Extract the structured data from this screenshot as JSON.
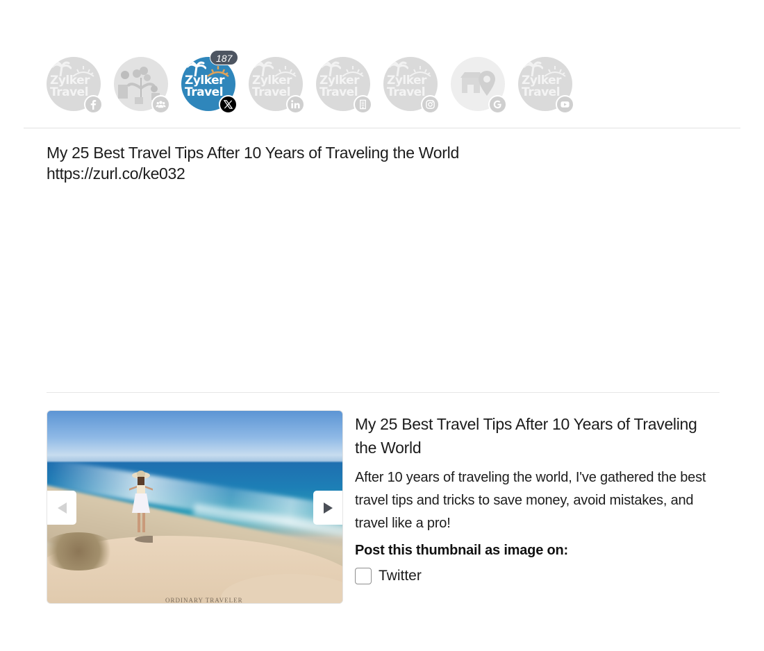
{
  "accounts": {
    "items": [
      {
        "name": "Zylker Travel",
        "network": "Facebook",
        "badge_icon": "facebook-icon",
        "active": false
      },
      {
        "name": "Community Group",
        "network": "Facebook Group",
        "badge_icon": "group-icon",
        "active": false
      },
      {
        "name": "Zylker Travel",
        "network": "X (Twitter)",
        "badge_icon": "x-icon",
        "active": true
      },
      {
        "name": "Zylker Travel",
        "network": "LinkedIn",
        "badge_icon": "linkedin-icon",
        "active": false
      },
      {
        "name": "Zylker Travel",
        "network": "LinkedIn Page",
        "badge_icon": "building-icon",
        "active": false
      },
      {
        "name": "Zylker Travel",
        "network": "Instagram",
        "badge_icon": "instagram-icon",
        "active": false
      },
      {
        "name": "Store Location",
        "network": "Google Business Profile",
        "badge_icon": "google-icon",
        "active": false
      },
      {
        "name": "Zylker Travel",
        "network": "YouTube",
        "badge_icon": "youtube-icon",
        "active": false
      }
    ],
    "logo_line1": "Zylker",
    "logo_line2": "Travel",
    "active_char_count": "187",
    "active_color": "#2f86bb",
    "inactive_color": "#d6d6d6"
  },
  "post": {
    "line1": "My 25 Best Travel Tips After 10 Years of Traveling the World",
    "line2": "https://zurl.co/ke032"
  },
  "link_preview": {
    "image_alt": "Woman in white dress and sun hat on a sandy cliff overlooking the ocean",
    "watermark": "ORDINARY TRAVELER",
    "prev_label": "Previous image",
    "next_label": "Next image",
    "prev_enabled": false,
    "next_enabled": true,
    "title": "My 25 Best Travel Tips After 10 Years of Traveling the World",
    "description": "After 10 years of traveling the world, I've gathered the best travel tips and tricks to save money, avoid mistakes, and travel like a pro!",
    "thumbnail_option_label": "Post this thumbnail as image on:",
    "thumbnail_option_network": "Twitter",
    "thumbnail_option_checked": false
  }
}
